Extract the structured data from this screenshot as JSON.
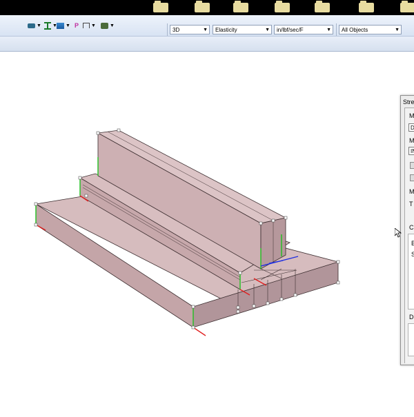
{
  "toolbar": {
    "view_mode": "3D",
    "analysis_type": "Elasticity",
    "units": "in/lbf/sec/F",
    "object_filter": "All Objects",
    "icons": [
      "shape-icon",
      "beam-icon",
      "layer-icon",
      "pin-icon",
      "support-icon",
      "camera-icon"
    ]
  },
  "panel": {
    "title": "Stre",
    "label_m1": "M",
    "field_d": "D",
    "label_m2": "M",
    "field_i": "IN",
    "label_m3": "M",
    "label_t": "T",
    "label_c": "C",
    "label_b": "B",
    "label_s": "S",
    "label_d": "D"
  },
  "colors": {
    "model_fill": "#c9acae",
    "model_top": "#d8bfc1",
    "model_side": "#b89b9e",
    "edge": "#3a2c2e",
    "axis_x": "#e02020",
    "axis_y": "#20c020",
    "axis_z": "#2030e0"
  }
}
